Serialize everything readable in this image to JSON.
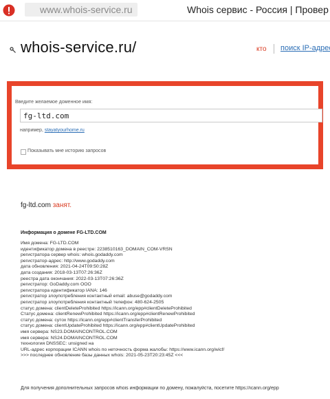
{
  "browser": {
    "security_icon": "warning-triangle-icon",
    "url": "www.whois-service.ru",
    "tab_title": "Whois сервис - Россия | Провер"
  },
  "header": {
    "logo_icon": "key-icon",
    "title": "whois-service.ru/",
    "nav_kto": "кто",
    "nav_ip": "поиск IP-адрес"
  },
  "search": {
    "label": "Введите желаемое доменное имя:",
    "value": "fg-ltd.com",
    "example_prefix": "например, ",
    "example_link": "stayatyourhome.ru",
    "history_label": "Показывать мне историю запросов",
    "accent_color": "#e8442a"
  },
  "result": {
    "domain": "fg-ltd.com",
    "status": "занят.",
    "info_heading": "Информация о домене FG-LTD.COM",
    "lines": [
      "Имя домена: FG-LTD.COM",
      "идентификатор домена в реестре: 2238510163_DOMAIN_COM-VRSN",
      "регистратора сервер whois: whois.godaddy.com",
      "регистратор-адрес: http://www.godaddy.com",
      "дата обновления: 2021-04-24T09:50:28Z",
      "дата создания: 2018-03-13T07:26:36Z",
      "реестра дата окончания: 2022-03-13T07:26:36Z",
      "регистратор: GoDaddy.com ООО",
      "регистратора идентификатор IANA: 146",
      "регистратор злоупотребления контактный email: abuse@godaddy.com",
      "регистратор злоупотребления контактный телефон: 480-624-2505",
      "статус домена: clientDeleteProhibited https://icann.org/epp#clientDeleteProhibited",
      "Статус домена: clientRenewProhibited https://icann.org/epp#clientRenewProhibited",
      "статус домена: сутох https://icann.org/epp#clientTransferProhibited",
      "статус домена: clientUpdateProhibited https://icann.org/epp#clientUpdateProhibited",
      "имя сервера: NS23.DOMAINCONTROL.COM",
      "имя сервера: NS24.DOMAINCONTROL.COM",
      "технология DNSSEC: unsigned на",
      "URL-адрес корпорации ICANN whois по неточность форма жалобы: https://www.icann.org/wicf/",
      ">>> последнее обновление базы данных whois: 2021-05-23T20:23:45Z <<<"
    ],
    "footer": "Для получения дополнительных запросов whois информации по домену, пожалуйста, посетите https://icann.org/epp"
  }
}
